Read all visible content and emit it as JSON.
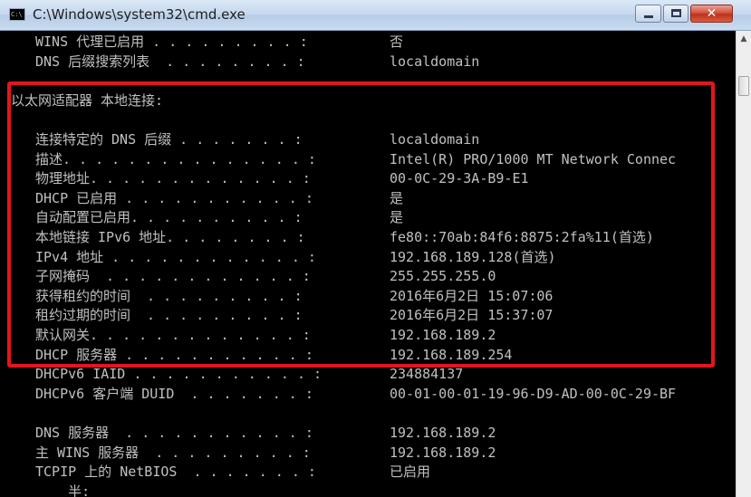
{
  "window": {
    "title": "C:\\Windows\\system32\\cmd.exe",
    "icon_text": "C:\\",
    "minimize_icon": "minimize-icon",
    "maximize_icon": "maximize-icon",
    "close_icon": "close-icon",
    "close_glyph": "✕"
  },
  "scrollbar": {
    "up_glyph": "▲"
  },
  "highlight_color": "#e2161b",
  "console": {
    "lines": [
      {
        "label": "WINS 代理已启用 . . . . . . . . . :",
        "value": "否"
      },
      {
        "label": "DNS 后缀搜索列表  . . . . . . . . :",
        "value": "localdomain"
      },
      {
        "label": "",
        "value": ""
      },
      {
        "label": "以太网适配器 本地连接:",
        "value": ""
      },
      {
        "label": "",
        "value": ""
      },
      {
        "label": "连接特定的 DNS 后缀 . . . . . . . :",
        "value": "localdomain"
      },
      {
        "label": "描述. . . . . . . . . . . . . . . :",
        "value": "Intel(R) PRO/1000 MT Network Connec"
      },
      {
        "label": "物理地址. . . . . . . . . . . . . :",
        "value": "00-0C-29-3A-B9-E1"
      },
      {
        "label": "DHCP 已启用 . . . . . . . . . . . :",
        "value": "是"
      },
      {
        "label": "自动配置已启用. . . . . . . . . . :",
        "value": "是"
      },
      {
        "label": "本地链接 IPv6 地址. . . . . . . . :",
        "value": "fe80::70ab:84f6:8875:2fa%11(首选)"
      },
      {
        "label": "IPv4 地址 . . . . . . . . . . . . :",
        "value": "192.168.189.128(首选)"
      },
      {
        "label": "子网掩码  . . . . . . . . . . . . :",
        "value": "255.255.255.0"
      },
      {
        "label": "获得租约的时间  . . . . . . . . . :",
        "value": "2016年6月2日 15:07:06"
      },
      {
        "label": "租约过期的时间  . . . . . . . . . :",
        "value": "2016年6月2日 15:37:07"
      },
      {
        "label": "默认网关. . . . . . . . . . . . . :",
        "value": "192.168.189.2"
      },
      {
        "label": "DHCP 服务器 . . . . . . . . . . . :",
        "value": "192.168.189.254"
      },
      {
        "label": "DHCPv6 IAID . . . . . . . . . . . :",
        "value": "234884137"
      },
      {
        "label": "DHCPv6 客户端 DUID  . . . . . . . :",
        "value": "00-01-00-01-19-96-D9-AD-00-0C-29-BF"
      },
      {
        "label": "",
        "value": ""
      },
      {
        "label": "DNS 服务器  . . . . . . . . . . . :",
        "value": "192.168.189.2"
      },
      {
        "label": "主 WINS 服务器  . . . . . . . . . :",
        "value": "192.168.189.2"
      },
      {
        "label": "TCPIP 上的 NetBIOS  . . . . . . . :",
        "value": "已启用"
      },
      {
        "label": "    半:",
        "value": ""
      }
    ]
  }
}
